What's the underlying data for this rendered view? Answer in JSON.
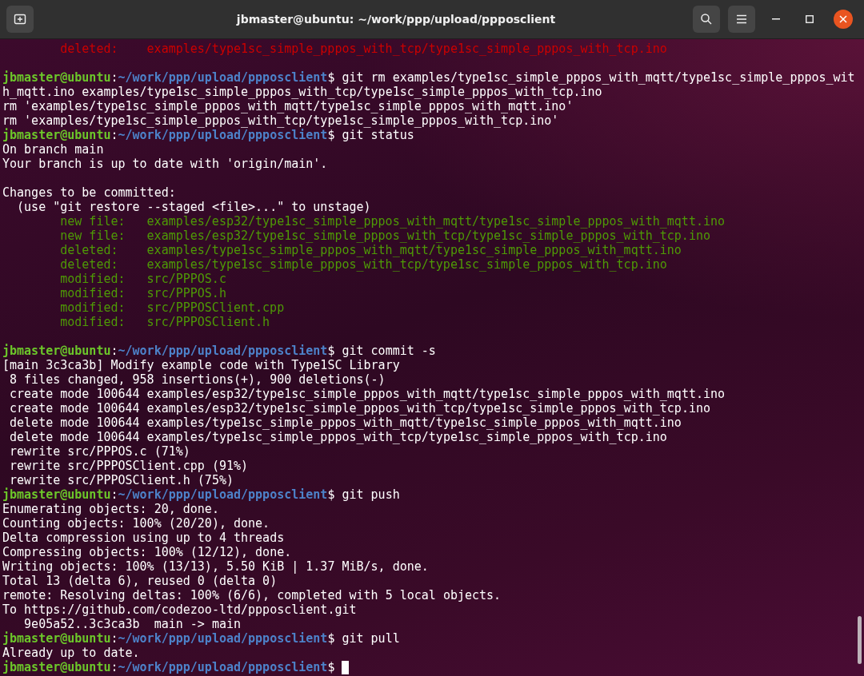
{
  "window": {
    "title": "jbmaster@ubuntu: ~/work/ppp/upload/ppposclient"
  },
  "lines": [
    {
      "kind": "staged",
      "label": "deleted:",
      "path": "examples/type1sc_simple_pppos_with_tcp/type1sc_simple_pppos_with_tcp.ino",
      "color": "#cc0000"
    },
    {
      "kind": "blank"
    },
    {
      "kind": "prompt",
      "user": "jbmaster@ubuntu",
      "separator": ":",
      "path": "~/work/ppp/upload/ppposclient",
      "command": "$ git rm examples/type1sc_simple_pppos_with_mqtt/type1sc_simple_pppos_wit"
    },
    {
      "kind": "output",
      "text": "h_mqtt.ino examples/type1sc_simple_pppos_with_tcp/type1sc_simple_pppos_with_tcp.ino"
    },
    {
      "kind": "output",
      "text": "rm 'examples/type1sc_simple_pppos_with_mqtt/type1sc_simple_pppos_with_mqtt.ino'"
    },
    {
      "kind": "output",
      "text": "rm 'examples/type1sc_simple_pppos_with_tcp/type1sc_simple_pppos_with_tcp.ino'"
    },
    {
      "kind": "prompt",
      "user": "jbmaster@ubuntu",
      "separator": ":",
      "path": "~/work/ppp/upload/ppposclient",
      "command": "$ git status"
    },
    {
      "kind": "output",
      "text": "On branch main"
    },
    {
      "kind": "output",
      "text": "Your branch is up to date with 'origin/main'."
    },
    {
      "kind": "blank"
    },
    {
      "kind": "output",
      "text": "Changes to be committed:"
    },
    {
      "kind": "output",
      "text": "  (use \"git restore --staged <file>...\" to unstage)"
    },
    {
      "kind": "staged",
      "label": "new file:",
      "path": "examples/esp32/type1sc_simple_pppos_with_mqtt/type1sc_simple_pppos_with_mqtt.ino",
      "color": "#4e9a06"
    },
    {
      "kind": "staged",
      "label": "new file:",
      "path": "examples/esp32/type1sc_simple_pppos_with_tcp/type1sc_simple_pppos_with_tcp.ino",
      "color": "#4e9a06"
    },
    {
      "kind": "staged",
      "label": "deleted:",
      "path": "examples/type1sc_simple_pppos_with_mqtt/type1sc_simple_pppos_with_mqtt.ino",
      "color": "#4e9a06"
    },
    {
      "kind": "staged",
      "label": "deleted:",
      "path": "examples/type1sc_simple_pppos_with_tcp/type1sc_simple_pppos_with_tcp.ino",
      "color": "#4e9a06"
    },
    {
      "kind": "staged",
      "label": "modified:",
      "path": "src/PPPOS.c",
      "color": "#4e9a06"
    },
    {
      "kind": "staged",
      "label": "modified:",
      "path": "src/PPPOS.h",
      "color": "#4e9a06"
    },
    {
      "kind": "staged",
      "label": "modified:",
      "path": "src/PPPOSClient.cpp",
      "color": "#4e9a06"
    },
    {
      "kind": "staged",
      "label": "modified:",
      "path": "src/PPPOSClient.h",
      "color": "#4e9a06"
    },
    {
      "kind": "blank"
    },
    {
      "kind": "prompt",
      "user": "jbmaster@ubuntu",
      "separator": ":",
      "path": "~/work/ppp/upload/ppposclient",
      "command": "$ git commit -s"
    },
    {
      "kind": "output",
      "text": "[main 3c3ca3b] Modify example code with Type1SC Library"
    },
    {
      "kind": "output",
      "text": " 8 files changed, 958 insertions(+), 900 deletions(-)"
    },
    {
      "kind": "output",
      "text": " create mode 100644 examples/esp32/type1sc_simple_pppos_with_mqtt/type1sc_simple_pppos_with_mqtt.ino"
    },
    {
      "kind": "output",
      "text": " create mode 100644 examples/esp32/type1sc_simple_pppos_with_tcp/type1sc_simple_pppos_with_tcp.ino"
    },
    {
      "kind": "output",
      "text": " delete mode 100644 examples/type1sc_simple_pppos_with_mqtt/type1sc_simple_pppos_with_mqtt.ino"
    },
    {
      "kind": "output",
      "text": " delete mode 100644 examples/type1sc_simple_pppos_with_tcp/type1sc_simple_pppos_with_tcp.ino"
    },
    {
      "kind": "output",
      "text": " rewrite src/PPPOS.c (71%)"
    },
    {
      "kind": "output",
      "text": " rewrite src/PPPOSClient.cpp (91%)"
    },
    {
      "kind": "output",
      "text": " rewrite src/PPPOSClient.h (75%)"
    },
    {
      "kind": "prompt",
      "user": "jbmaster@ubuntu",
      "separator": ":",
      "path": "~/work/ppp/upload/ppposclient",
      "command": "$ git push"
    },
    {
      "kind": "output",
      "text": "Enumerating objects: 20, done."
    },
    {
      "kind": "output",
      "text": "Counting objects: 100% (20/20), done."
    },
    {
      "kind": "output",
      "text": "Delta compression using up to 4 threads"
    },
    {
      "kind": "output",
      "text": "Compressing objects: 100% (12/12), done."
    },
    {
      "kind": "output",
      "text": "Writing objects: 100% (13/13), 5.50 KiB | 1.37 MiB/s, done."
    },
    {
      "kind": "output",
      "text": "Total 13 (delta 6), reused 0 (delta 0)"
    },
    {
      "kind": "output",
      "text": "remote: Resolving deltas: 100% (6/6), completed with 5 local objects."
    },
    {
      "kind": "output",
      "text": "To https://github.com/codezoo-ltd/ppposclient.git"
    },
    {
      "kind": "output",
      "text": "   9e05a52..3c3ca3b  main -> main"
    },
    {
      "kind": "prompt",
      "user": "jbmaster@ubuntu",
      "separator": ":",
      "path": "~/work/ppp/upload/ppposclient",
      "command": "$ git pull"
    },
    {
      "kind": "output",
      "text": "Already up to date."
    },
    {
      "kind": "prompt",
      "user": "jbmaster@ubuntu",
      "separator": ":",
      "path": "~/work/ppp/upload/ppposclient",
      "command": "$ ",
      "cursor": true
    }
  ]
}
